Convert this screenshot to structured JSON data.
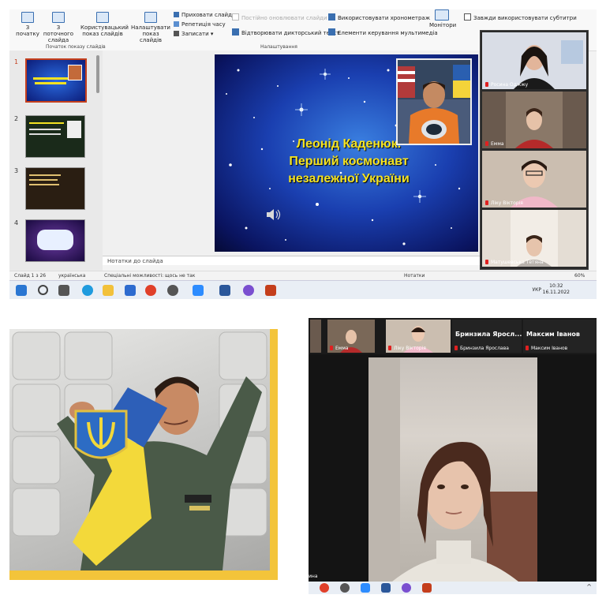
{
  "ribbon": {
    "btn_from_start": "З початку",
    "btn_from_current": "З поточного слайда",
    "btn_custom_show": "Користувацький показ слайдів",
    "btn_setup_show": "Налаштувати показ слайдів",
    "hide_slide": "Приховати слайд",
    "rehearse": "Репетиція часу",
    "record": "Записати",
    "cb_always_refresh": "Постійно оновлювати слайди",
    "cb_play_narration": "Відтворювати дикторський текст",
    "cb_use_timings": "Використовувати хронометраж",
    "cb_media_controls": "Елементи керування мультимедіа",
    "btn_monitors": "Монітори",
    "cb_always_subtitles": "Завжди використовувати субтитри",
    "group_start": "Початок показу слайдів",
    "group_setup": "Налаштування"
  },
  "slides": {
    "numbers": [
      "1",
      "2",
      "3",
      "4"
    ],
    "main_title_line1": "Леонід Каденюк.",
    "main_title_line2": "Перший космонавт",
    "main_title_line3": "незалежної України"
  },
  "notes_placeholder": "Нотатки до слайда",
  "status": {
    "slide_counter": "Слайд 1 з 26",
    "language": "українська",
    "accessibility": "Спеціальні можливості: щось не так",
    "notes_btn": "Нотатки",
    "zoom": "60%"
  },
  "taskbar": {
    "lang": "УКР",
    "time": "10:32",
    "date": "16.11.2022"
  },
  "video_panel": {
    "participants": [
      "Росина Оджжу",
      "Емма",
      "Ліку Вікторія",
      "Матушевська Тетяна"
    ]
  },
  "zoom_bottom": {
    "strip_names": [
      "Емма",
      "Ліку Вікторія",
      "Бринзила Ярослава",
      "Максим Іванов"
    ],
    "big_names": [
      "Бринзила Яросл...",
      "Максим Іванов"
    ],
    "speaker_partial": "ина"
  },
  "colors": {
    "slide_title": "#f3e222",
    "frame_yellow": "#f3c43a",
    "ppt_red": "#c43e1c",
    "mic_muted": "#e02020"
  }
}
